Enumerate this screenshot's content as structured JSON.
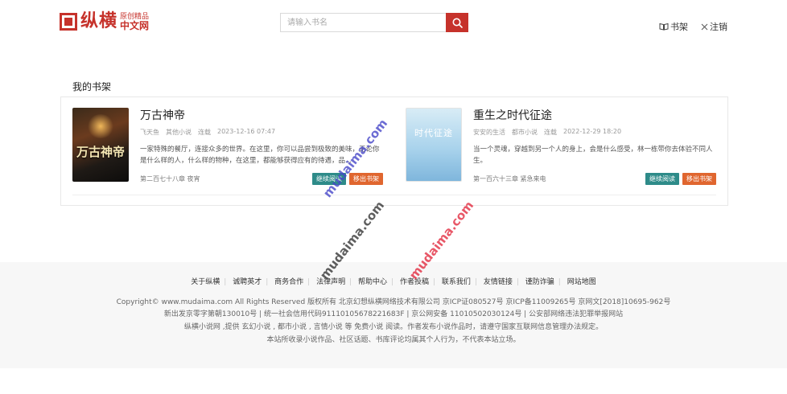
{
  "header": {
    "logo_main": "纵横",
    "logo_sub1": "原创精品",
    "logo_sub2": "中文网",
    "search_placeholder": "请输入书名",
    "shelf_link": "书架",
    "logout_link": "注销"
  },
  "shelf": {
    "title": "我的书架",
    "books": [
      {
        "title": "万古神帝",
        "cover_text": "万古神帝",
        "author": "飞天鱼",
        "category": "其他小说",
        "status": "连载",
        "updated": "2023-12-16 07:47",
        "description": "一家特殊的餐厅，连接众多的世界。在这里，你可以品尝到极致的美味，无论你是什么样的人，什么样的物种，在这里，都能够获得应有的待遇，品...",
        "latest_chapter": "第二百七十八章 夜宵",
        "read_label": "继续阅读",
        "remove_label": "移出书架"
      },
      {
        "title": "重生之时代征途",
        "cover_text": "时代征途",
        "author": "安安的生活",
        "category": "都市小说",
        "status": "连载",
        "updated": "2022-12-29 18:20",
        "description": "当一个灵魂，穿越到另一个人的身上，会是什么感受，林一栋带你去体验不同人生。",
        "latest_chapter": "第一百六十三章 紧急来电",
        "read_label": "继续阅读",
        "remove_label": "移出书架"
      }
    ]
  },
  "footer": {
    "links": [
      "关于纵横",
      "诚聘英才",
      "商务合作",
      "法律声明",
      "帮助中心",
      "作者投稿",
      "联系我们",
      "友情链接",
      "谨防诈骗",
      "网站地图"
    ],
    "line1": "Copyright© www.mudaima.com All Rights Reserved 版权所有 北京幻想纵横网络技术有限公司   京ICP证080527号   京ICP备11009265号   京网文[2018]10695-962号",
    "line2": "新出发京零字第朝130010号    |   统一社会信用代码91110105678221683F   |   京公网安备 11010502030124号    |   公安部网络违法犯罪举报网站",
    "line3": "纵横小说网 ,提供 玄幻小说 , 都市小说 , 言情小说 等 免费小说 阅读。作者发布小说作品时，请遵守国家互联网信息管理办法规定。",
    "line4": "本站所收录小说作品、社区话题、书库评论均属其个人行为，不代表本站立场。"
  },
  "watermarks": [
    "mudaima.com",
    "mudaima.com",
    "mudaima.com"
  ]
}
